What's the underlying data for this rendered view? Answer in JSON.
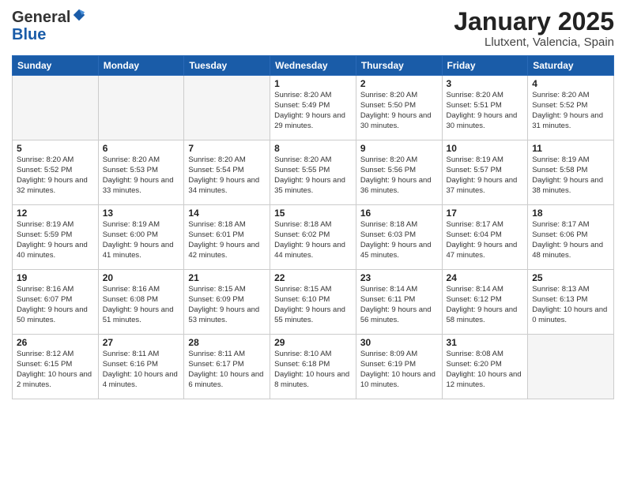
{
  "header": {
    "logo_general": "General",
    "logo_blue": "Blue",
    "title": "January 2025",
    "subtitle": "Llutxent, Valencia, Spain"
  },
  "weekdays": [
    "Sunday",
    "Monday",
    "Tuesday",
    "Wednesday",
    "Thursday",
    "Friday",
    "Saturday"
  ],
  "weeks": [
    [
      {
        "day": "",
        "info": ""
      },
      {
        "day": "",
        "info": ""
      },
      {
        "day": "",
        "info": ""
      },
      {
        "day": "1",
        "info": "Sunrise: 8:20 AM\nSunset: 5:49 PM\nDaylight: 9 hours and 29 minutes."
      },
      {
        "day": "2",
        "info": "Sunrise: 8:20 AM\nSunset: 5:50 PM\nDaylight: 9 hours and 30 minutes."
      },
      {
        "day": "3",
        "info": "Sunrise: 8:20 AM\nSunset: 5:51 PM\nDaylight: 9 hours and 30 minutes."
      },
      {
        "day": "4",
        "info": "Sunrise: 8:20 AM\nSunset: 5:52 PM\nDaylight: 9 hours and 31 minutes."
      }
    ],
    [
      {
        "day": "5",
        "info": "Sunrise: 8:20 AM\nSunset: 5:52 PM\nDaylight: 9 hours and 32 minutes."
      },
      {
        "day": "6",
        "info": "Sunrise: 8:20 AM\nSunset: 5:53 PM\nDaylight: 9 hours and 33 minutes."
      },
      {
        "day": "7",
        "info": "Sunrise: 8:20 AM\nSunset: 5:54 PM\nDaylight: 9 hours and 34 minutes."
      },
      {
        "day": "8",
        "info": "Sunrise: 8:20 AM\nSunset: 5:55 PM\nDaylight: 9 hours and 35 minutes."
      },
      {
        "day": "9",
        "info": "Sunrise: 8:20 AM\nSunset: 5:56 PM\nDaylight: 9 hours and 36 minutes."
      },
      {
        "day": "10",
        "info": "Sunrise: 8:19 AM\nSunset: 5:57 PM\nDaylight: 9 hours and 37 minutes."
      },
      {
        "day": "11",
        "info": "Sunrise: 8:19 AM\nSunset: 5:58 PM\nDaylight: 9 hours and 38 minutes."
      }
    ],
    [
      {
        "day": "12",
        "info": "Sunrise: 8:19 AM\nSunset: 5:59 PM\nDaylight: 9 hours and 40 minutes."
      },
      {
        "day": "13",
        "info": "Sunrise: 8:19 AM\nSunset: 6:00 PM\nDaylight: 9 hours and 41 minutes."
      },
      {
        "day": "14",
        "info": "Sunrise: 8:18 AM\nSunset: 6:01 PM\nDaylight: 9 hours and 42 minutes."
      },
      {
        "day": "15",
        "info": "Sunrise: 8:18 AM\nSunset: 6:02 PM\nDaylight: 9 hours and 44 minutes."
      },
      {
        "day": "16",
        "info": "Sunrise: 8:18 AM\nSunset: 6:03 PM\nDaylight: 9 hours and 45 minutes."
      },
      {
        "day": "17",
        "info": "Sunrise: 8:17 AM\nSunset: 6:04 PM\nDaylight: 9 hours and 47 minutes."
      },
      {
        "day": "18",
        "info": "Sunrise: 8:17 AM\nSunset: 6:06 PM\nDaylight: 9 hours and 48 minutes."
      }
    ],
    [
      {
        "day": "19",
        "info": "Sunrise: 8:16 AM\nSunset: 6:07 PM\nDaylight: 9 hours and 50 minutes."
      },
      {
        "day": "20",
        "info": "Sunrise: 8:16 AM\nSunset: 6:08 PM\nDaylight: 9 hours and 51 minutes."
      },
      {
        "day": "21",
        "info": "Sunrise: 8:15 AM\nSunset: 6:09 PM\nDaylight: 9 hours and 53 minutes."
      },
      {
        "day": "22",
        "info": "Sunrise: 8:15 AM\nSunset: 6:10 PM\nDaylight: 9 hours and 55 minutes."
      },
      {
        "day": "23",
        "info": "Sunrise: 8:14 AM\nSunset: 6:11 PM\nDaylight: 9 hours and 56 minutes."
      },
      {
        "day": "24",
        "info": "Sunrise: 8:14 AM\nSunset: 6:12 PM\nDaylight: 9 hours and 58 minutes."
      },
      {
        "day": "25",
        "info": "Sunrise: 8:13 AM\nSunset: 6:13 PM\nDaylight: 10 hours and 0 minutes."
      }
    ],
    [
      {
        "day": "26",
        "info": "Sunrise: 8:12 AM\nSunset: 6:15 PM\nDaylight: 10 hours and 2 minutes."
      },
      {
        "day": "27",
        "info": "Sunrise: 8:11 AM\nSunset: 6:16 PM\nDaylight: 10 hours and 4 minutes."
      },
      {
        "day": "28",
        "info": "Sunrise: 8:11 AM\nSunset: 6:17 PM\nDaylight: 10 hours and 6 minutes."
      },
      {
        "day": "29",
        "info": "Sunrise: 8:10 AM\nSunset: 6:18 PM\nDaylight: 10 hours and 8 minutes."
      },
      {
        "day": "30",
        "info": "Sunrise: 8:09 AM\nSunset: 6:19 PM\nDaylight: 10 hours and 10 minutes."
      },
      {
        "day": "31",
        "info": "Sunrise: 8:08 AM\nSunset: 6:20 PM\nDaylight: 10 hours and 12 minutes."
      },
      {
        "day": "",
        "info": ""
      }
    ]
  ]
}
